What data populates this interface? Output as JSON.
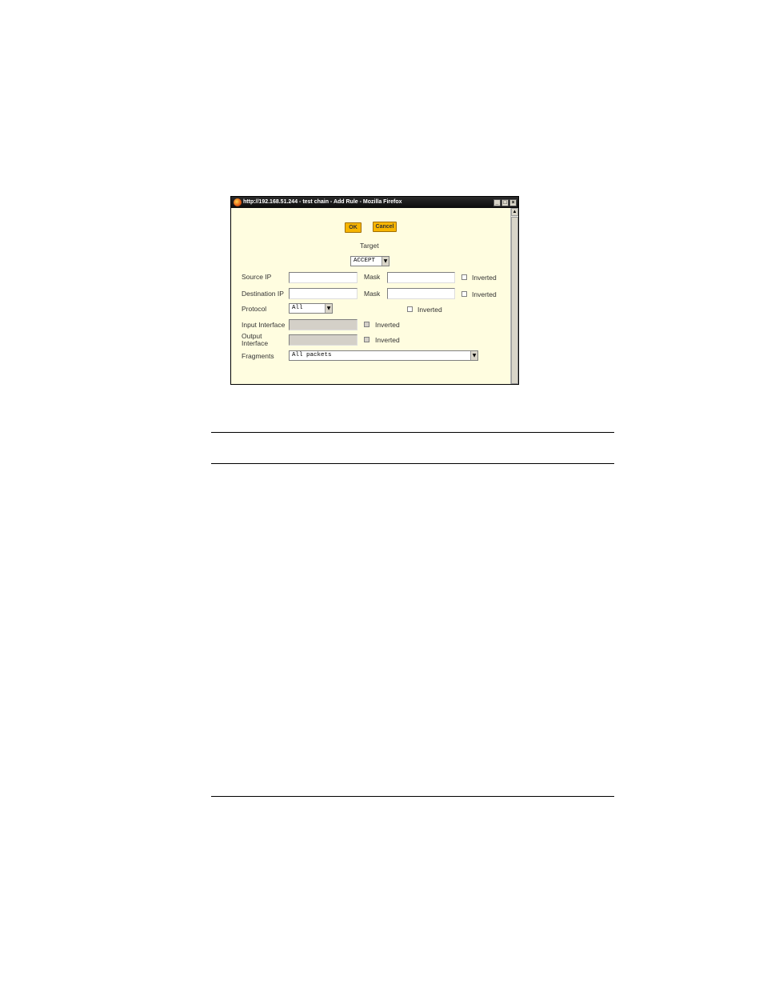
{
  "window": {
    "title": "http://192.168.51.244 - test chain - Add Rule - Mozilla Firefox"
  },
  "buttons": {
    "ok": "OK",
    "cancel": "Cancel"
  },
  "target": {
    "label": "Target",
    "value": "ACCEPT"
  },
  "source_ip": {
    "label": "Source IP",
    "value": "",
    "mask_label": "Mask",
    "mask_value": "",
    "inverted_label": "Inverted"
  },
  "destination_ip": {
    "label": "Destination IP",
    "value": "",
    "mask_label": "Mask",
    "mask_value": "",
    "inverted_label": "Inverted"
  },
  "protocol": {
    "label": "Protocol",
    "value": "All",
    "inverted_label": "Inverted"
  },
  "input_interface": {
    "label": "Input Interface",
    "value": "",
    "inverted_label": "Inverted"
  },
  "output_interface": {
    "label_line1": "Output",
    "label_line2": "Interface",
    "value": "",
    "inverted_label": "Inverted"
  },
  "fragments": {
    "label": "Fragments",
    "value": "All packets"
  },
  "icons": [
    "firefox-icon",
    "minimize-icon",
    "maximize-icon",
    "close-icon",
    "scroll-up-icon",
    "dropdown-arrow-icon"
  ]
}
